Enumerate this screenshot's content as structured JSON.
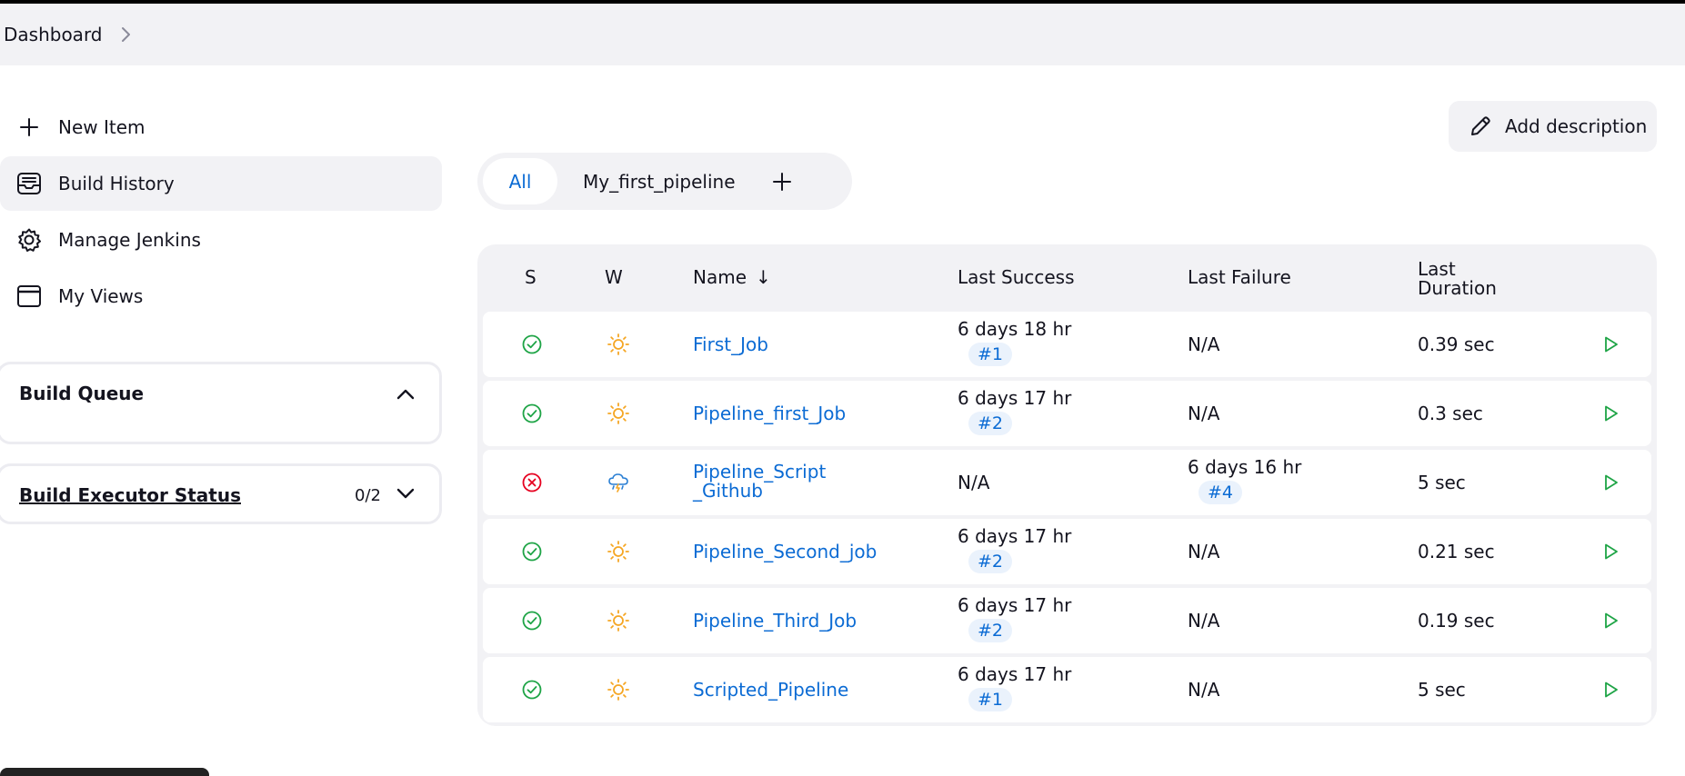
{
  "breadcrumb": {
    "items": [
      "Dashboard"
    ]
  },
  "sidebar": {
    "items": [
      {
        "label": "New Item",
        "icon": "plus-icon"
      },
      {
        "label": "Build History",
        "icon": "inbox-icon"
      },
      {
        "label": "Manage Jenkins",
        "icon": "gear-icon"
      },
      {
        "label": "My Views",
        "icon": "window-icon"
      }
    ],
    "active_index": 1
  },
  "build_queue": {
    "title": "Build Queue",
    "expanded": true
  },
  "executor_status": {
    "title": "Build Executor Status",
    "count": "0/2",
    "expanded": false
  },
  "add_description": {
    "label": "Add description"
  },
  "view_tabs": {
    "tabs": [
      "All",
      "My_first_pipeline"
    ],
    "active": "All"
  },
  "table": {
    "headers": {
      "status": "S",
      "weather": "W",
      "name": "Name",
      "name_sort": "↓",
      "last_success": "Last Success",
      "last_failure": "Last Failure",
      "last_duration": "Last Duration"
    },
    "rows": [
      {
        "status": "success",
        "weather": "sunny",
        "name": "First_Job",
        "last_success": "6 days 18 hr",
        "success_build": "#1",
        "last_failure": "N/A",
        "failure_build": "",
        "duration": "0.39 sec"
      },
      {
        "status": "success",
        "weather": "sunny",
        "name": "Pipeline_first_Job",
        "last_success": "6 days 17 hr",
        "success_build": "#2",
        "last_failure": "N/A",
        "failure_build": "",
        "duration": "0.3 sec"
      },
      {
        "status": "failed",
        "weather": "thunderstorm",
        "name_line1": "Pipeline_Script",
        "name_line2": "_Github",
        "last_success": "N/A",
        "success_build": "",
        "last_failure": "6 days 16 hr",
        "failure_build": "#4",
        "duration": "5 sec"
      },
      {
        "status": "success",
        "weather": "sunny",
        "name": "Pipeline_Second_job",
        "last_success": "6 days 17 hr",
        "success_build": "#2",
        "last_failure": "N/A",
        "failure_build": "",
        "duration": "0.21 sec"
      },
      {
        "status": "success",
        "weather": "sunny",
        "name": "Pipeline_Third_Job",
        "last_success": "6 days 17 hr",
        "success_build": "#2",
        "last_failure": "N/A",
        "failure_build": "",
        "duration": "0.19 sec"
      },
      {
        "status": "success",
        "weather": "sunny",
        "name": "Scripted_Pipeline",
        "last_success": "6 days 17 hr",
        "success_build": "#1",
        "last_failure": "N/A",
        "failure_build": "",
        "duration": "5 sec"
      }
    ]
  },
  "colors": {
    "link": "#0b6bd4",
    "success": "#1ea446",
    "failure": "#e6001f",
    "sunny": "#f5a623",
    "surface": "#f2f2f5"
  }
}
